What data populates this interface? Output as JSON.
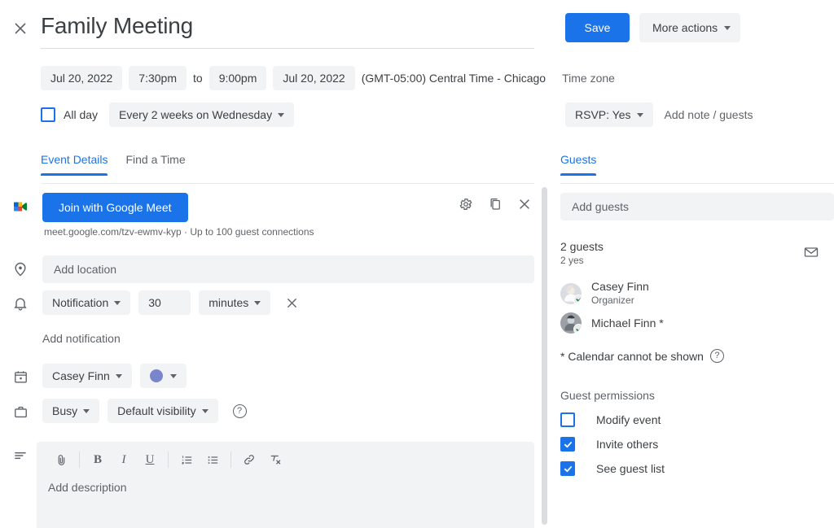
{
  "header": {
    "close_icon": "close-icon",
    "title": "Family Meeting",
    "save_label": "Save",
    "more_actions_label": "More actions"
  },
  "schedule": {
    "start_date": "Jul 20, 2022",
    "start_time": "7:30pm",
    "to_label": "to",
    "end_time": "9:00pm",
    "end_date": "Jul 20, 2022",
    "timezone": "(GMT-05:00) Central Time - Chicago",
    "timezone_label": "Time zone",
    "all_day_label": "All day",
    "all_day_checked": false,
    "recurrence": "Every 2 weeks on Wednesday"
  },
  "rsvp": {
    "value": "RSVP: Yes",
    "add_note_label": "Add note / guests"
  },
  "tabs": {
    "left": [
      {
        "label": "Event Details",
        "active": true
      },
      {
        "label": "Find a Time",
        "active": false
      }
    ],
    "right": [
      {
        "label": "Guests",
        "active": true
      }
    ]
  },
  "conference": {
    "rail_icon": "google-meet-icon",
    "join_label": "Join with Google Meet",
    "link_text": "meet.google.com/tzv-ewmv-kyp · Up to 100 guest connections",
    "settings_icon": "gear-icon",
    "copy_icon": "copy-icon",
    "remove_icon": "close-icon"
  },
  "location": {
    "rail_icon": "location-pin-icon",
    "placeholder": "Add location"
  },
  "notification": {
    "rail_icon": "bell-icon",
    "type": "Notification",
    "amount": "30",
    "unit": "minutes",
    "remove_icon": "close-icon",
    "add_label": "Add notification"
  },
  "calendar": {
    "rail_icon": "calendar-icon",
    "owner": "Casey Finn",
    "color_hex": "#7986cb",
    "color_name": "blueberry-swatch"
  },
  "availability": {
    "rail_icon": "briefcase-icon",
    "busy": "Busy",
    "visibility": "Default visibility",
    "help_icon": "help-icon",
    "help_glyph": "?"
  },
  "description": {
    "rail_icon": "description-lines-icon",
    "placeholder": "Add description",
    "toolbar": [
      {
        "name": "attach-icon",
        "glyph": "attach"
      },
      {
        "name": "bold-icon",
        "glyph": "B"
      },
      {
        "name": "italic-icon",
        "glyph": "I"
      },
      {
        "name": "underline-icon",
        "glyph": "U"
      },
      {
        "name": "numbered-list-icon",
        "glyph": "ol"
      },
      {
        "name": "bullet-list-icon",
        "glyph": "ul"
      },
      {
        "name": "link-icon",
        "glyph": "link"
      },
      {
        "name": "clear-formatting-icon",
        "glyph": "clear"
      }
    ]
  },
  "guests": {
    "add_placeholder": "Add guests",
    "count_text": "2 guests",
    "yes_text": "2 yes",
    "email_icon": "email-icon",
    "list": [
      {
        "name": "Casey Finn",
        "role": "Organizer",
        "rsvp_icon": "check-icon"
      },
      {
        "name": "Michael Finn *",
        "role": "",
        "rsvp_icon": "check-icon"
      }
    ],
    "calendar_note": "* Calendar cannot be shown",
    "calendar_note_help_icon": "help-icon",
    "permissions_title": "Guest permissions",
    "permissions": [
      {
        "label": "Modify event",
        "checked": false
      },
      {
        "label": "Invite others",
        "checked": true
      },
      {
        "label": "See guest list",
        "checked": true
      }
    ]
  },
  "theme": {
    "accent": "#1a73e8",
    "chip_bg": "#f1f3f4",
    "text": "#3c4043",
    "muted": "#5f6368"
  }
}
